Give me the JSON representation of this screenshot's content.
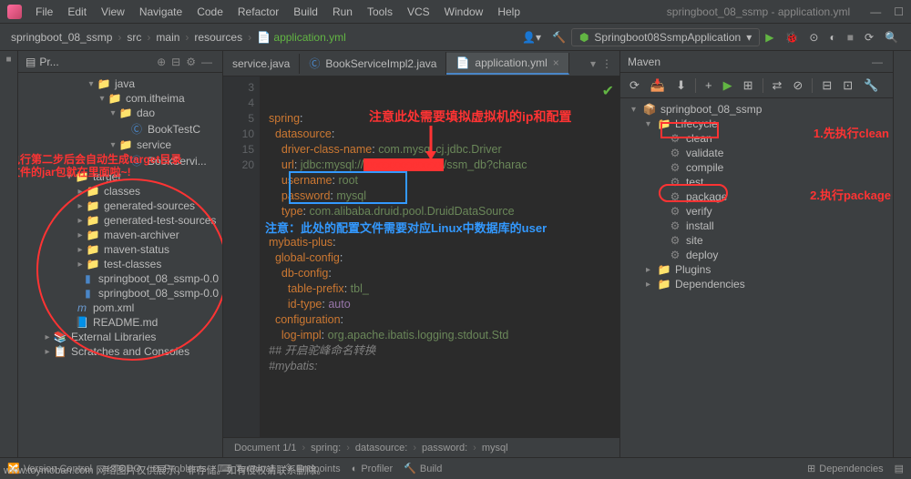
{
  "window": {
    "title": "springboot_08_ssmp - application.yml"
  },
  "menu": [
    "File",
    "Edit",
    "View",
    "Navigate",
    "Code",
    "Refactor",
    "Build",
    "Run",
    "Tools",
    "VCS",
    "Window",
    "Help"
  ],
  "nav": {
    "crumbs": [
      "springboot_08_ssmp",
      "src",
      "main",
      "resources",
      "application.yml"
    ],
    "run_config": "Springboot08SsmpApplication"
  },
  "project": {
    "title": "Pr...",
    "tree": {
      "java": "java",
      "pkg": "com.itheima",
      "dao": "dao",
      "booktestc": "BookTestC",
      "service": "service",
      "booksvc": "BookServi...",
      "target": "target",
      "classes": "classes",
      "gensrc": "generated-sources",
      "gentsrc": "generated-test-sources",
      "mvnarch": "maven-archiver",
      "mvnstat": "maven-status",
      "testcls": "test-classes",
      "jar1": "springboot_08_ssmp-0.0",
      "jar2": "springboot_08_ssmp-0.0",
      "pom": "pom.xml",
      "readme": "README.md",
      "extlib": "External Libraries",
      "scratch": "Scratches and Consoles"
    }
  },
  "tabs": {
    "t1": "service.java",
    "t2": "BookServiceImpl2.java",
    "t3": "application.yml"
  },
  "code": {
    "l3": {
      "k": "spring",
      "c": ":"
    },
    "l4": {
      "k": "datasource",
      "c": ":"
    },
    "l5": {
      "k": "driver-class-name",
      "c": ": ",
      "v": "com.mysql.cj.jdbc.Driver"
    },
    "l6": {
      "k": "url",
      "c": ": ",
      "v1": "jdbc:mysql://",
      "v2": "/ssm_db?charac"
    },
    "l7": {
      "k": "username",
      "c": ": ",
      "v": "root"
    },
    "l8": {
      "k": "password",
      "c": ": ",
      "v": "mysql"
    },
    "l9": {
      "k": "type",
      "c": ": ",
      "v": "com.alibaba.druid.pool.DruidDataSource"
    },
    "l11": {
      "k": "mybatis-plus",
      "c": ":"
    },
    "l12": {
      "k": "global-config",
      "c": ":"
    },
    "l13": {
      "k": "db-config",
      "c": ":"
    },
    "l14": {
      "k": "table-prefix",
      "c": ": ",
      "v": "tbl_"
    },
    "l15": {
      "k": "id-type",
      "c": ": ",
      "v": "auto"
    },
    "l16": {
      "k": "configuration",
      "c": ":"
    },
    "l17": {
      "k": "log-impl",
      "c": ": ",
      "v": "org.apache.ibatis.logging.stdout.Std"
    },
    "l18": "## 开启驼峰命名转换",
    "l19": "#mybatis:"
  },
  "gutter": [
    "",
    "",
    "3",
    "4",
    "5",
    "",
    "",
    "",
    "",
    "10",
    "",
    "",
    "",
    "",
    "15",
    "",
    "",
    "",
    "",
    "20",
    ""
  ],
  "annotations": {
    "top_red": "注意此处需要填拟虚拟机的ip和配置",
    "blue_note": "注意：此处的配置文件需要对应Linux中数据库的user",
    "tree_note_1": "执行第二步后会自动生成target目录",
    "tree_note_2": "文件的jar包就在里面啦~!",
    "maven_1": "1.先执行clean",
    "maven_2": "2.执行package"
  },
  "breadcrumb": {
    "doc": "Document 1/1",
    "items": [
      "spring:",
      "datasource:",
      "password:",
      "mysql"
    ]
  },
  "maven": {
    "title": "Maven",
    "root": "springboot_08_ssmp",
    "lifecycle": "Lifecycle",
    "goals": [
      "clean",
      "validate",
      "compile",
      "test",
      "package",
      "verify",
      "install",
      "site",
      "deploy"
    ],
    "plugins": "Plugins",
    "deps": "Dependencies"
  },
  "bottom": {
    "version": "Version Control",
    "todo": "TODO",
    "problems": "Problems",
    "terminal": "Terminal",
    "endpoints": "Endpoints",
    "profiler": "Profiler",
    "build": "Build",
    "deps": "Dependencies"
  },
  "watermark": "www.toymoban.com  网络图片仅供展示，非存储。如有侵权请联系删除。"
}
